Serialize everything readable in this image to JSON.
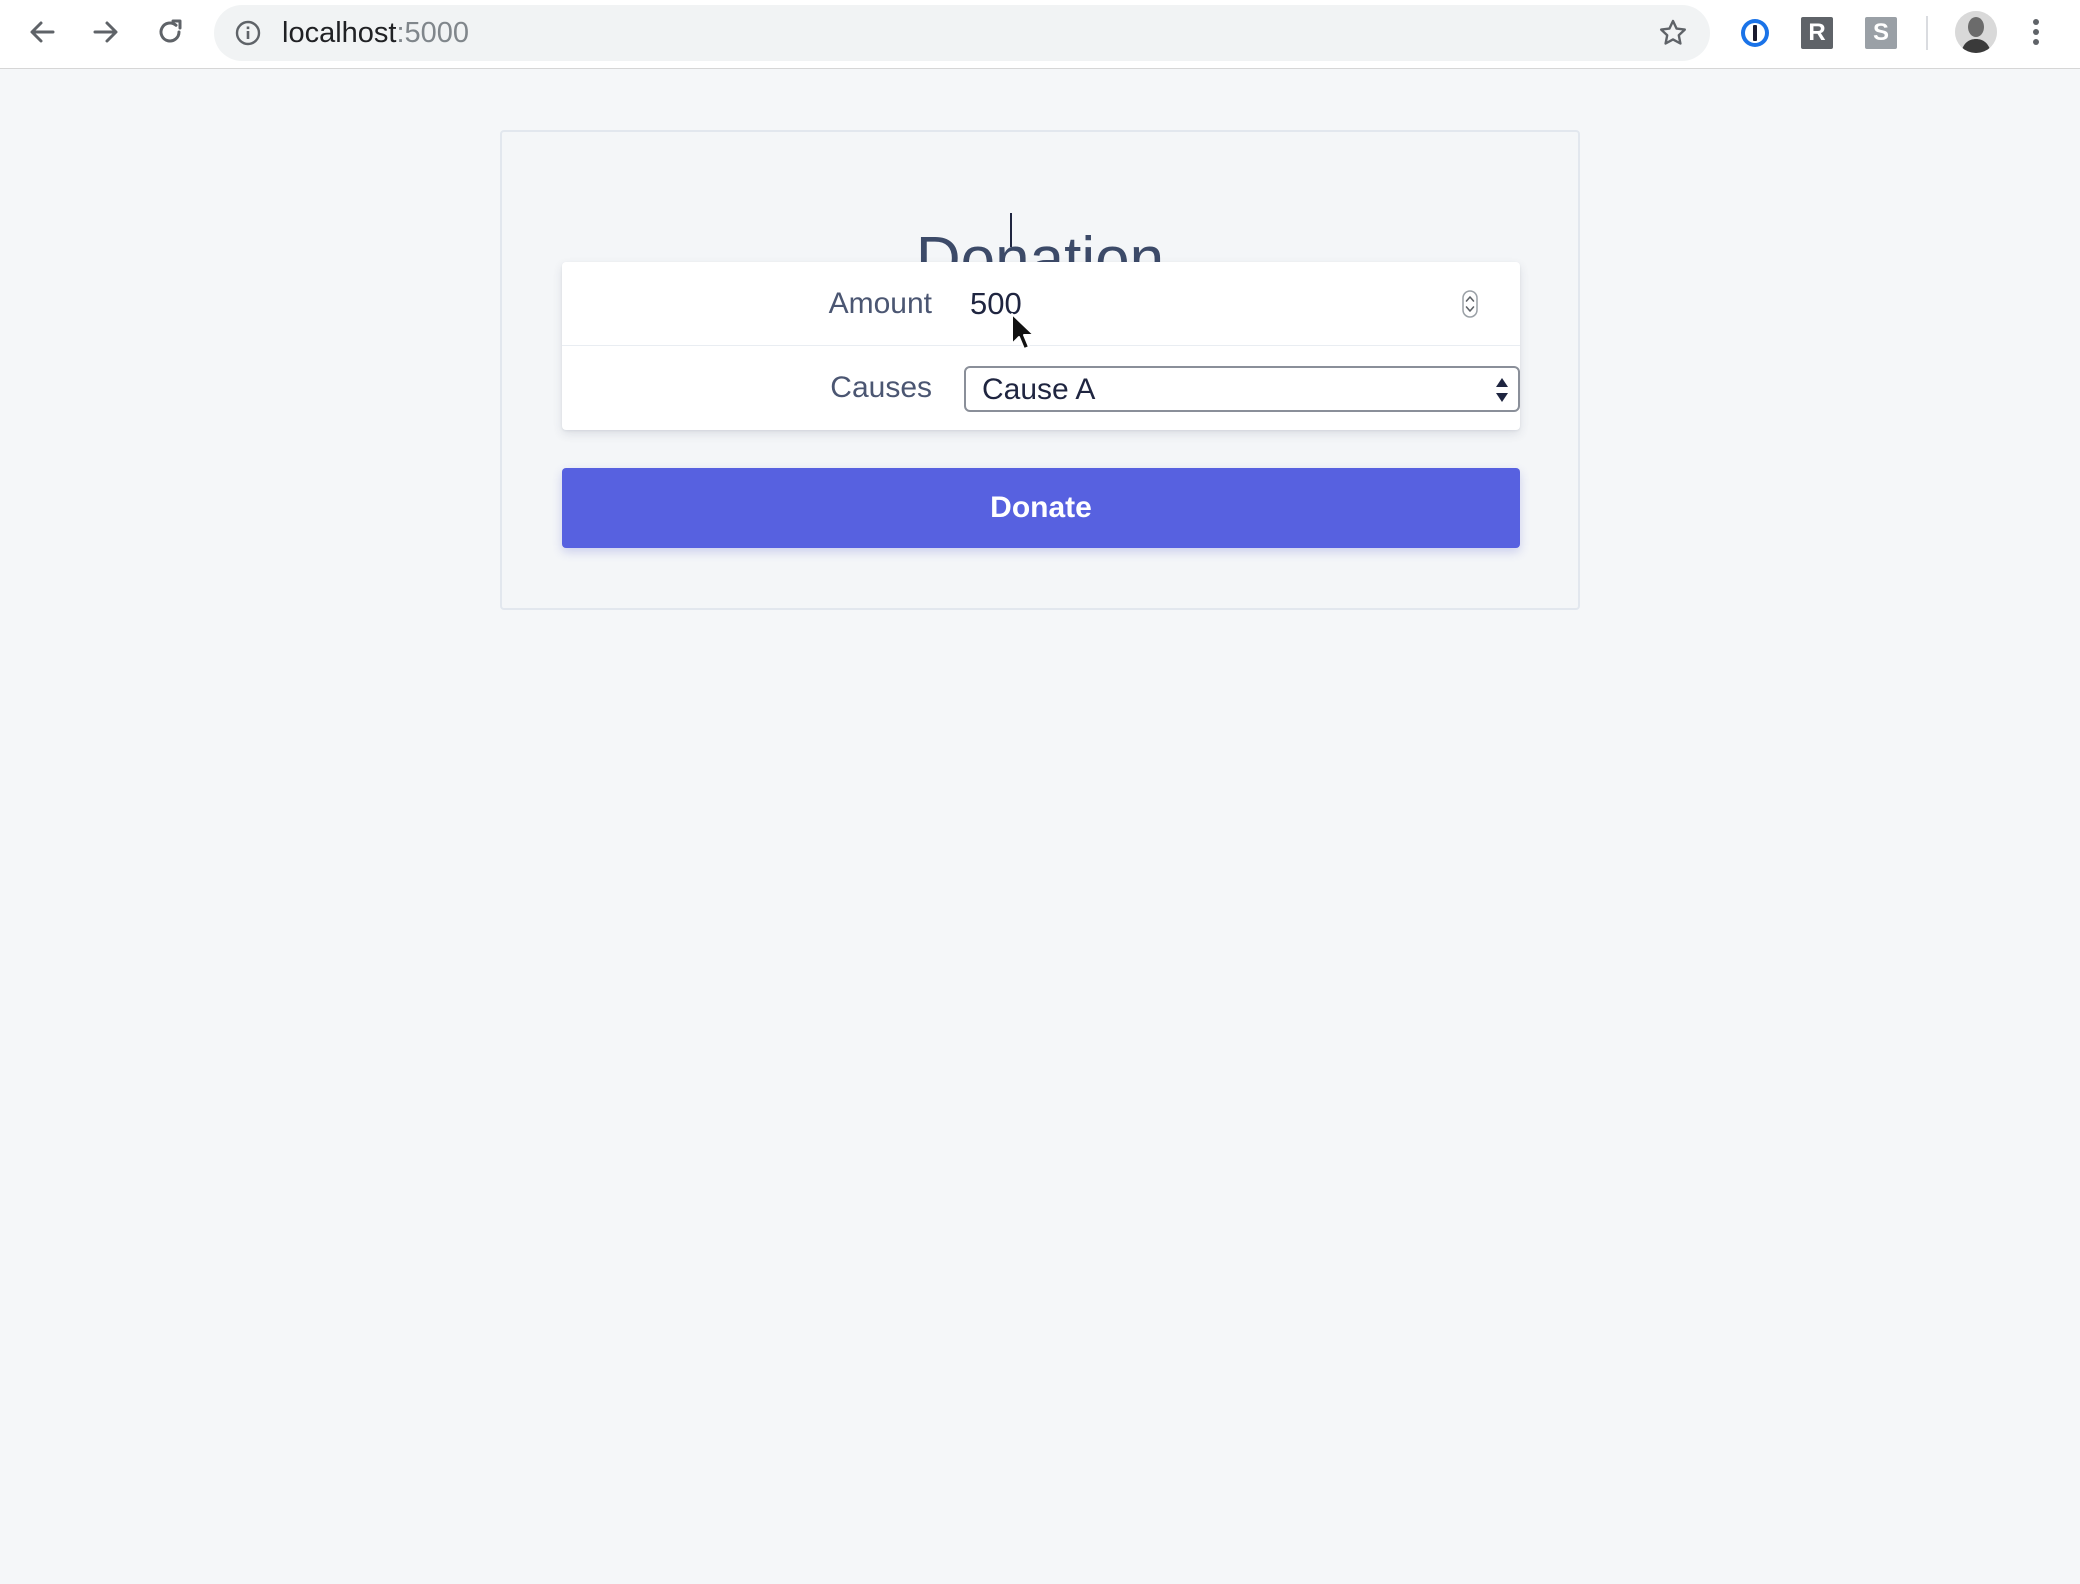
{
  "browser": {
    "url_host": "localhost",
    "url_port": ":5000",
    "extensions": {
      "r_label": "R",
      "s_label": "S"
    },
    "icons": {
      "back": "arrow-left-icon",
      "forward": "arrow-right-icon",
      "reload": "reload-icon",
      "info": "info-icon",
      "bookmark": "star-icon",
      "password_manager": "1password-icon",
      "menu": "kebab-menu-icon"
    }
  },
  "form": {
    "title": "Donation",
    "amount": {
      "label": "Amount",
      "value": "500"
    },
    "causes": {
      "label": "Causes",
      "selected": "Cause A"
    },
    "submit_label": "Donate"
  },
  "colors": {
    "accent": "#5761e0",
    "title_text": "#3c4a68",
    "page_background": "#f5f7f9"
  }
}
